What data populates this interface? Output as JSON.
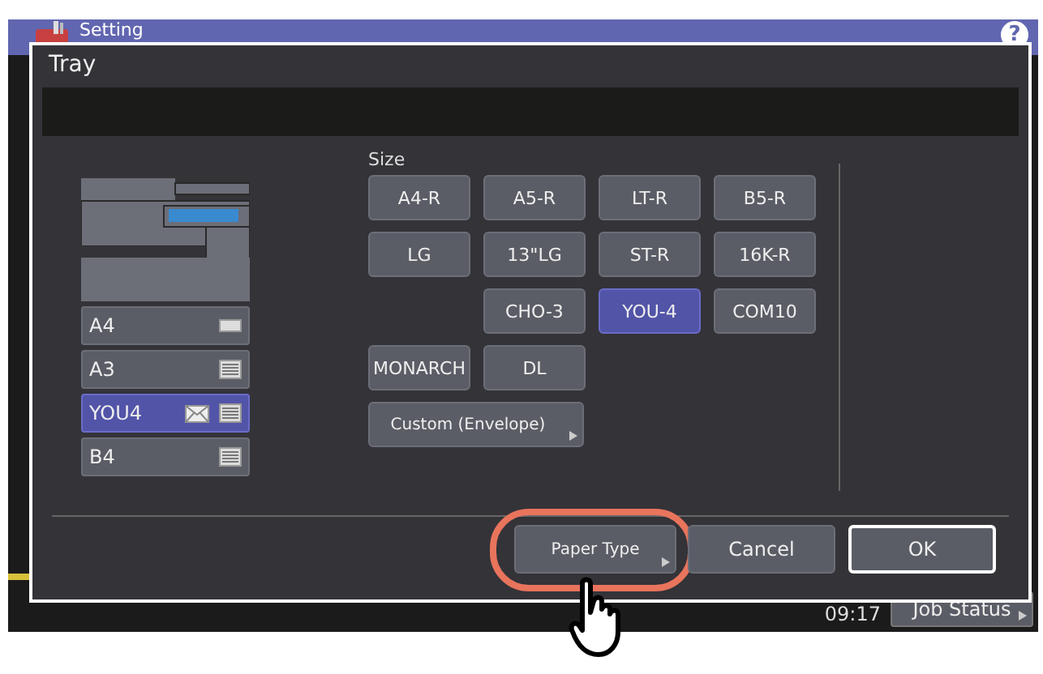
{
  "screen": {
    "title": "Setting",
    "help": "?",
    "time": "09:17",
    "job_status": "Job Status"
  },
  "dialog": {
    "title": "Tray",
    "trays": [
      {
        "label": "A4",
        "kind": "low",
        "selected": false
      },
      {
        "label": "A3",
        "kind": "stack",
        "selected": false
      },
      {
        "label": "YOU4",
        "kind": "envelope",
        "selected": true
      },
      {
        "label": "B4",
        "kind": "stack",
        "selected": false
      }
    ],
    "size_label": "Size",
    "size_rows": [
      {
        "indent": false,
        "items": [
          {
            "label": "A4-R",
            "selected": false
          },
          {
            "label": "A5-R",
            "selected": false
          },
          {
            "label": "LT-R",
            "selected": false
          },
          {
            "label": "B5-R",
            "selected": false
          }
        ]
      },
      {
        "indent": false,
        "items": [
          {
            "label": "LG",
            "selected": false
          },
          {
            "label": "13\"LG",
            "selected": false
          },
          {
            "label": "ST-R",
            "selected": false
          },
          {
            "label": "16K-R",
            "selected": false
          }
        ]
      },
      {
        "indent": true,
        "items": [
          {
            "label": "CHO-3",
            "selected": false
          },
          {
            "label": "YOU-4",
            "selected": true
          },
          {
            "label": "COM10",
            "selected": false
          }
        ]
      },
      {
        "indent": false,
        "items": [
          {
            "label": "MONARCH",
            "selected": false
          },
          {
            "label": "DL",
            "selected": false
          }
        ]
      }
    ],
    "custom": {
      "label": "Custom (Envelope)"
    },
    "buttons": [
      {
        "label": "Paper Type",
        "kind": "submenu",
        "highlighted": true
      },
      {
        "label": "Cancel",
        "kind": "plain",
        "highlighted": false
      },
      {
        "label": "OK",
        "kind": "default",
        "highlighted": false
      }
    ]
  }
}
